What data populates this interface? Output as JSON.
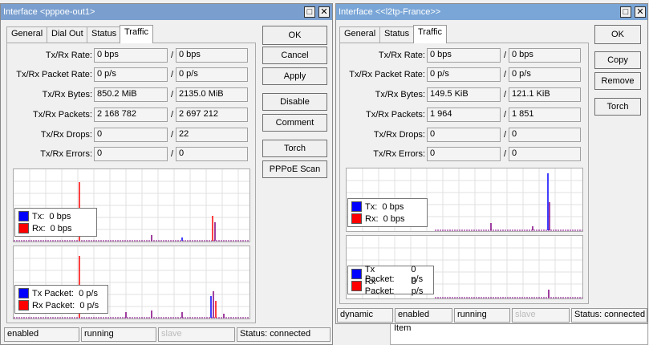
{
  "left": {
    "title": "Interface <pppoe-out1>",
    "tabs": [
      "General",
      "Dial Out",
      "Status",
      "Traffic"
    ],
    "rows": [
      {
        "label": "Tx/Rx Rate:",
        "tx": "0 bps",
        "rx": "0 bps"
      },
      {
        "label": "Tx/Rx Packet Rate:",
        "tx": "0 p/s",
        "rx": "0 p/s"
      },
      {
        "label": "Tx/Rx Bytes:",
        "tx": "850.2 MiB",
        "rx": "2135.0 MiB"
      },
      {
        "label": "Tx/Rx Packets:",
        "tx": "2 168 782",
        "rx": "2 697 212"
      },
      {
        "label": "Tx/Rx Drops:",
        "tx": "0",
        "rx": "22"
      },
      {
        "label": "Tx/Rx Errors:",
        "tx": "0",
        "rx": "0"
      }
    ],
    "buttons": [
      "OK",
      "Cancel",
      "Apply",
      "Disable",
      "Comment",
      "Torch",
      "PPPoE Scan"
    ],
    "graph1": {
      "tx": "Tx:",
      "tx_val": "0 bps",
      "rx": "Rx:",
      "rx_val": "0 bps"
    },
    "graph2": {
      "tx": "Tx Packet:",
      "tx_val": "0 p/s",
      "rx": "Rx Packet:",
      "rx_val": "0 p/s"
    },
    "status": [
      "enabled",
      "running",
      "slave",
      "Status: connected"
    ]
  },
  "right": {
    "title": "Interface <<l2tp-France>>",
    "tabs": [
      "General",
      "Status",
      "Traffic"
    ],
    "rows": [
      {
        "label": "Tx/Rx Rate:",
        "tx": "0 bps",
        "rx": "0 bps"
      },
      {
        "label": "Tx/Rx Packet Rate:",
        "tx": "0 p/s",
        "rx": "0 p/s"
      },
      {
        "label": "Tx/Rx Bytes:",
        "tx": "149.5 KiB",
        "rx": "121.1 KiB"
      },
      {
        "label": "Tx/Rx Packets:",
        "tx": "1 964",
        "rx": "1 851"
      },
      {
        "label": "Tx/Rx Drops:",
        "tx": "0",
        "rx": "0"
      },
      {
        "label": "Tx/Rx Errors:",
        "tx": "0",
        "rx": "0"
      }
    ],
    "buttons": [
      "OK",
      "Copy",
      "Remove",
      "Torch"
    ],
    "graph1": {
      "tx": "Tx:",
      "tx_val": "0 bps",
      "rx": "Rx:",
      "rx_val": "0 bps"
    },
    "graph2": {
      "tx": "Tx Packet:",
      "tx_val": "0 p/s",
      "rx": "Rx Packet:",
      "rx_val": "0 p/s"
    },
    "status": [
      "dynamic",
      "enabled",
      "running",
      "slave",
      "Status: connected"
    ]
  },
  "background_text": "Item",
  "colors": {
    "tx": "#0000ff",
    "rx": "#ff0000",
    "titlebar": "#7a9fcf"
  }
}
